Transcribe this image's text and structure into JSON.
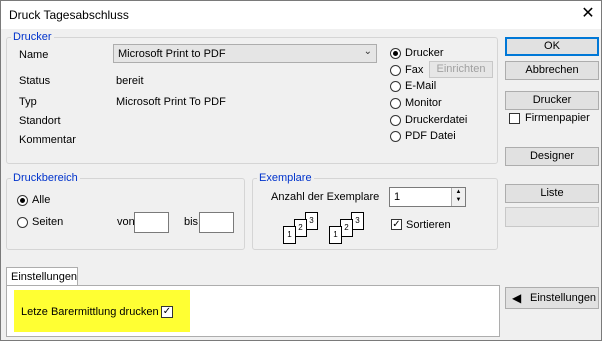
{
  "window": {
    "title": "Druck  Tagesabschluss"
  },
  "printer": {
    "legend": "Drucker",
    "name_label": "Name",
    "name_value": "Microsoft Print to PDF",
    "status_label": "Status",
    "status_value": "bereit",
    "type_label": "Typ",
    "type_value": "Microsoft Print To PDF",
    "location_label": "Standort",
    "comment_label": "Kommentar"
  },
  "output": {
    "options": [
      "Drucker",
      "Fax",
      "E-Mail",
      "Monitor",
      "Druckerdatei",
      "PDF Datei"
    ],
    "selected": "Drucker",
    "fax_setup_label": "Einrichten"
  },
  "buttons": {
    "ok": "OK",
    "cancel": "Abbrechen",
    "printer": "Drucker",
    "letterhead": "Firmenpapier",
    "designer": "Designer",
    "list": "Liste",
    "settings": "Einstellungen"
  },
  "range": {
    "legend": "Druckbereich",
    "all": "Alle",
    "pages": "Seiten",
    "from": "von",
    "to": "bis",
    "selected": "Alle"
  },
  "copies": {
    "legend": "Exemplare",
    "count_label": "Anzahl der Exemplare",
    "count_value": "1",
    "sort_label": "Sortieren",
    "sort_checked": true
  },
  "tabs": {
    "settings": "Einstellungen"
  },
  "settings_panel": {
    "last_cash_label": "Letze Barermittlung drucken",
    "last_cash_checked": true,
    "highlight_color": "#ffff33"
  }
}
